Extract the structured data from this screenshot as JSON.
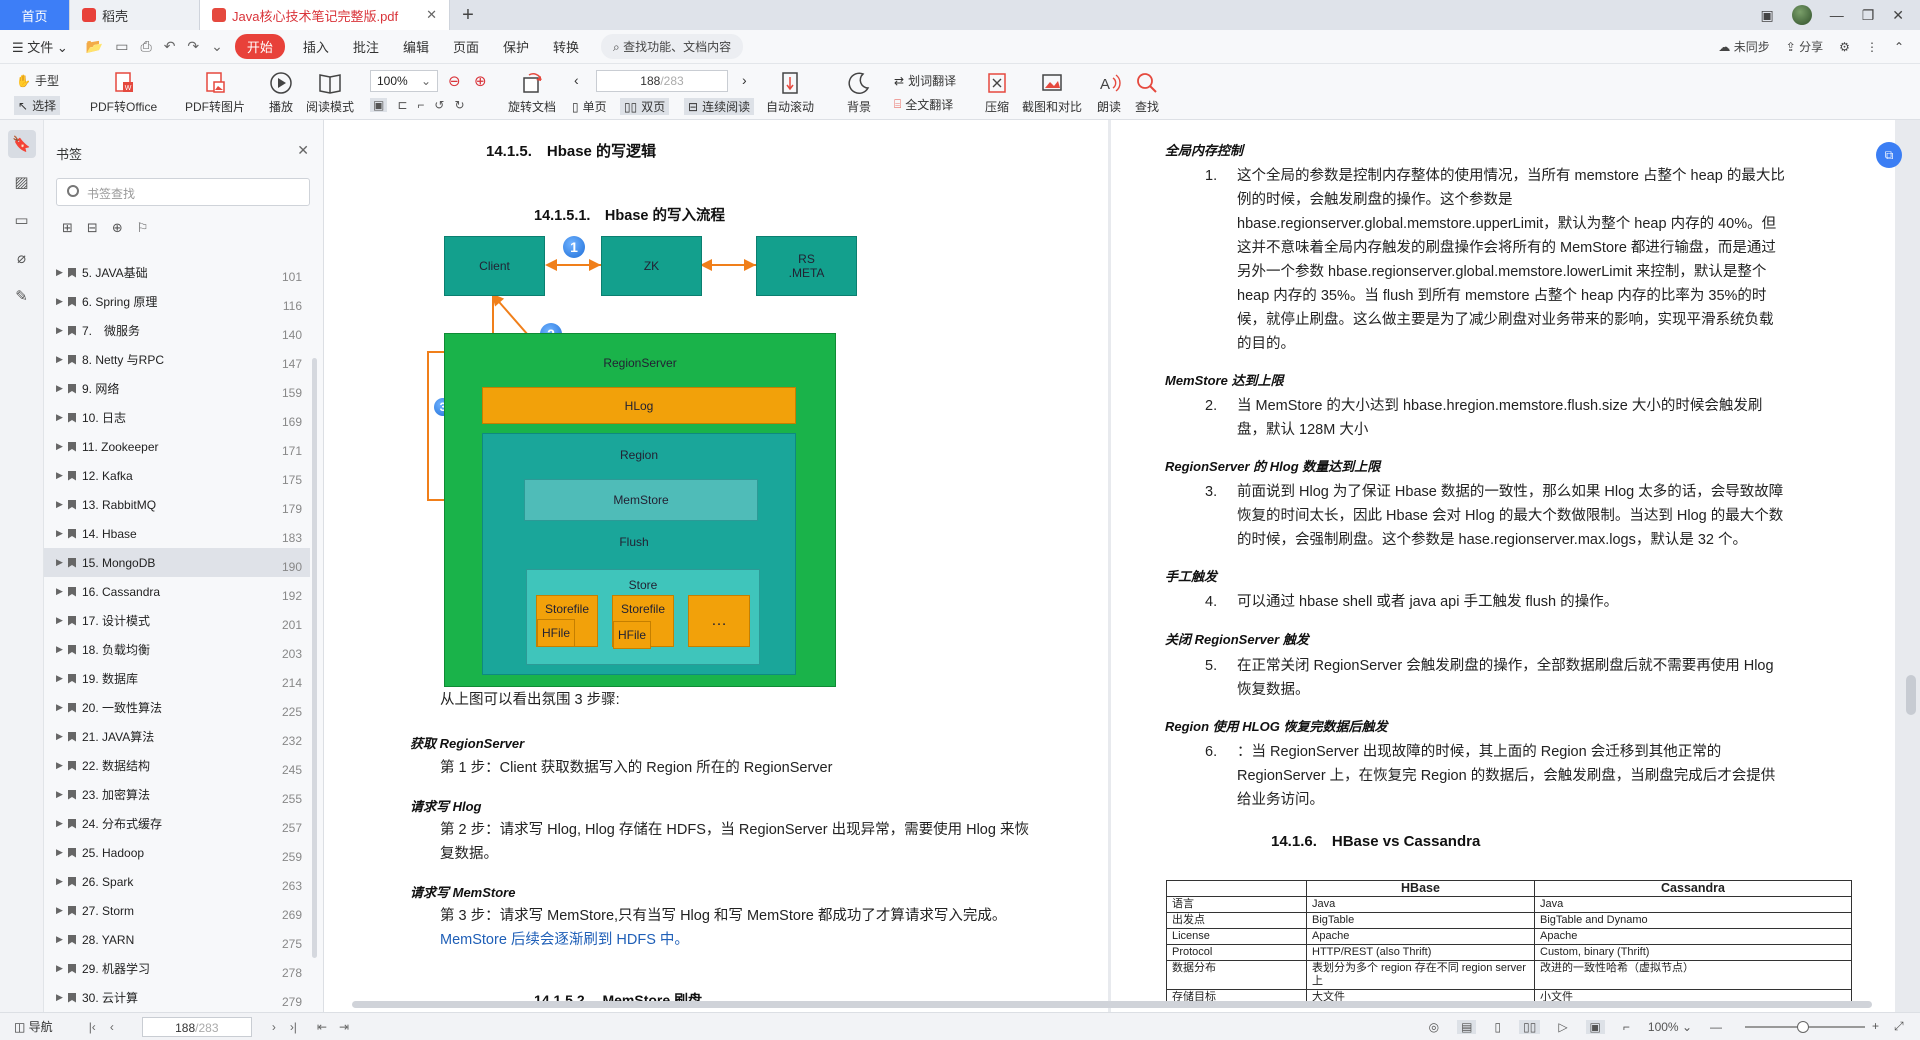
{
  "tabs": [
    {
      "label": "首页"
    },
    {
      "label": "稻壳"
    },
    {
      "label": "Java核心技术笔记完整版.pdf"
    }
  ],
  "menubar": {
    "file": "文件",
    "start": "开始",
    "items": [
      "插入",
      "批注",
      "编辑",
      "页面",
      "保护",
      "转换"
    ],
    "search": "查找功能、文档内容",
    "unsynced": "未同步",
    "share": "分享"
  },
  "ribbon": {
    "hand": "手型",
    "select": "选择",
    "pdf_office": "PDF转Office",
    "pdf_image": "PDF转图片",
    "play": "播放",
    "read_mode": "阅读模式",
    "zoom": "100%",
    "rotate": "旋转文档",
    "single": "单页",
    "double": "双页",
    "continuous": "连续阅读",
    "page_current": "188",
    "page_total": "/283",
    "auto_scroll": "自动滚动",
    "background": "背景",
    "word_translate": "划词翻译",
    "full_translate": "全文翻译",
    "compress": "压缩",
    "screenshot": "截图和对比",
    "read_aloud": "朗读",
    "find": "查找"
  },
  "bookmarks": {
    "title": "书签",
    "search_placeholder": "书签查找",
    "items": [
      {
        "label": "5. JAVA基础",
        "page": "101"
      },
      {
        "label": "6. Spring 原理",
        "page": "116"
      },
      {
        "label": "7.　微服务",
        "page": "140"
      },
      {
        "label": "8. Netty 与RPC",
        "page": "147"
      },
      {
        "label": "9. 网络",
        "page": "159"
      },
      {
        "label": "10. 日志",
        "page": "169"
      },
      {
        "label": "11. Zookeeper",
        "page": "171"
      },
      {
        "label": "12. Kafka",
        "page": "175"
      },
      {
        "label": "13. RabbitMQ",
        "page": "179"
      },
      {
        "label": "14. Hbase",
        "page": "183"
      },
      {
        "label": "15. MongoDB",
        "page": "190"
      },
      {
        "label": "16. Cassandra",
        "page": "192"
      },
      {
        "label": "17. 设计模式",
        "page": "201"
      },
      {
        "label": "18. 负载均衡",
        "page": "203"
      },
      {
        "label": "19. 数据库",
        "page": "214"
      },
      {
        "label": "20. 一致性算法",
        "page": "225"
      },
      {
        "label": "21. JAVA算法",
        "page": "232"
      },
      {
        "label": "22. 数据结构",
        "page": "245"
      },
      {
        "label": "23. 加密算法",
        "page": "255"
      },
      {
        "label": "24. 分布式缓存",
        "page": "257"
      },
      {
        "label": "25. Hadoop",
        "page": "259"
      },
      {
        "label": "26. Spark",
        "page": "263"
      },
      {
        "label": "27. Storm",
        "page": "269"
      },
      {
        "label": "28. YARN",
        "page": "275"
      },
      {
        "label": "29. 机器学习",
        "page": "278"
      },
      {
        "label": "30. 云计算",
        "page": "279"
      }
    ]
  },
  "left_page": {
    "h_1415": "14.1.5.　Hbase 的写逻辑",
    "h_14151": "14.1.5.1.　Hbase 的写入流程",
    "diagram": {
      "client": "Client",
      "zk": "ZK",
      "rs_meta": "RS\n.META",
      "regionserver": "RegionServer",
      "hlog": "HLog",
      "region": "Region",
      "memstore": "MemStore",
      "flush": "Flush",
      "store": "Store",
      "storefile1": "Storefile",
      "hfile1": "HFile",
      "storefile2": "Storefile",
      "hfile2": "HFile",
      "ellipsis": "…",
      "n1": "1",
      "n2": "2",
      "n3": "3"
    },
    "intro": "从上图可以看出氛围 3 步骤:",
    "s1_title": "获取 RegionServer",
    "s1_text": "第 1 步：Client 获取数据写入的 Region 所在的 RegionServer",
    "s2_title": "请求写 Hlog",
    "s2_text": "第 2 步：请求写 Hlog, Hlog 存储在 HDFS，当 RegionServer 出现异常，需要使用 Hlog 来恢复数据。",
    "s3_title": "请求写 MemStore",
    "s3_text": "第 3 步：请求写 MemStore,只有当写 Hlog 和写 MemStore 都成功了才算请求写入完成。",
    "s3_blue": "MemStore 后续会逐渐刷到 HDFS 中。",
    "next_heading": "14.1.5.2.　MemStore 刷盘"
  },
  "right_page": {
    "t_global": "全局内存控制",
    "p1": "这个全局的参数是控制内存整体的使用情况，当所有 memstore 占整个 heap 的最大比例的时候，会触发刷盘的操作。这个参数是 hbase.regionserver.global.memstore.upperLimit，默认为整个 heap 内存的 40%。但这并不意味着全局内存触发的刷盘操作会将所有的 MemStore 都进行输盘，而是通过另外一个参数 hbase.regionserver.global.memstore.lowerLimit 来控制，默认是整个 heap 内存的 35%。当 flush 到所有 memstore 占整个 heap 内存的比率为 35%的时候，就停止刷盘。这么做主要是为了减少刷盘对业务带来的影响，实现平滑系统负载的目的。",
    "t_memstore": "MemStore 达到上限",
    "p2": "当 MemStore 的大小达到 hbase.hregion.memstore.flush.size 大小的时候会触发刷盘，默认 128M 大小",
    "t_hlog": "RegionServer 的 Hlog 数量达到上限",
    "p3": "前面说到 Hlog 为了保证 Hbase 数据的一致性，那么如果 Hlog 太多的话，会导致故障恢复的时间太长，因此 Hbase 会对 Hlog 的最大个数做限制。当达到 Hlog 的最大个数的时候，会强制刷盘。这个参数是 hase.regionserver.max.logs，默认是 32 个。",
    "t_manual": "手工触发",
    "p4": "可以通过 hbase shell 或者 java api 手工触发 flush 的操作。",
    "t_close": "关闭 RegionServer 触发",
    "p5": "在正常关闭 RegionServer 会触发刷盘的操作，全部数据刷盘后就不需要再使用 Hlog 恢复数据。",
    "t_recover": "Region 使用 HLOG 恢复完数据后触发",
    "p6": "：当 RegionServer 出现故障的时候，其上面的 Region 会迁移到其他正常的 RegionServer 上，在恢复完 Region 的数据后，会触发刷盘，当刷盘完成后才会提供给业务访问。",
    "h_1416": "14.1.6.　HBase vs Cassandra",
    "table": {
      "headers": [
        "",
        "HBase",
        "Cassandra"
      ],
      "rows": [
        [
          "语言",
          "Java",
          "Java"
        ],
        [
          "出发点",
          "BigTable",
          "BigTable and Dynamo"
        ],
        [
          "License",
          "Apache",
          "Apache"
        ],
        [
          "Protocol",
          "HTTP/REST (also Thrift)",
          "Custom, binary (Thrift)"
        ],
        [
          "数据分布",
          "表划分为多个 region 存在不同 region server 上",
          "改进的一致性哈希（虚拟节点）"
        ],
        [
          "存储目标",
          "大文件",
          "小文件"
        ]
      ]
    }
  },
  "statusbar": {
    "nav": "导航",
    "page_current": "188",
    "page_total": "/283",
    "zoom": "100%"
  }
}
